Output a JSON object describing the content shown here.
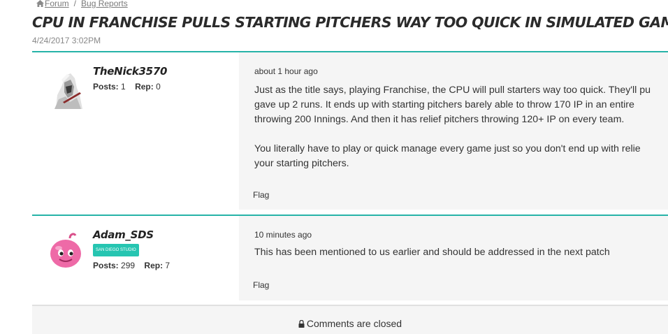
{
  "breadcrumb": {
    "icon": "home-icon",
    "forum_label": "Forum",
    "separator": "/",
    "section_label": "Bug Reports"
  },
  "thread": {
    "title": "CPU IN FRANCHISE PULLS STARTING PITCHERS WAY TOO QUICK IN SIMULATED GAMES",
    "date": "4/24/2017 3:02PM"
  },
  "labels": {
    "posts": "Posts:",
    "rep": "Rep:",
    "flag": "Flag"
  },
  "posts": [
    {
      "author": "TheNick3570",
      "posts_count": "1",
      "rep_count": "0",
      "timestamp": "about 1 hour ago",
      "paragraphs": [
        "Just as the title says, playing Franchise, the CPU will pull starters way too quick. They'll pu\ngave up 2 runs. It ends up with starting pitchers barely able to throw 170 IP in an entire\nthrowing 200 Innings. And then it has relief pitchers throwing 120+ IP on every team.",
        "You literally have to play or quick manage every game just so you don't end up with relie\nyour starting pitchers."
      ]
    },
    {
      "author": "Adam_SDS",
      "badge": "SAN DIEGO STUDIO",
      "posts_count": "299",
      "rep_count": "7",
      "timestamp": "10 minutes ago",
      "paragraphs": [
        "This has been mentioned to us earlier and should be addressed in the next patch"
      ]
    }
  ],
  "closed": {
    "icon": "lock-icon",
    "text": "Comments are closed"
  },
  "colors": {
    "accent": "#26b3a8",
    "badge": "#26c5b1",
    "post_background": "#f5f5f5"
  }
}
